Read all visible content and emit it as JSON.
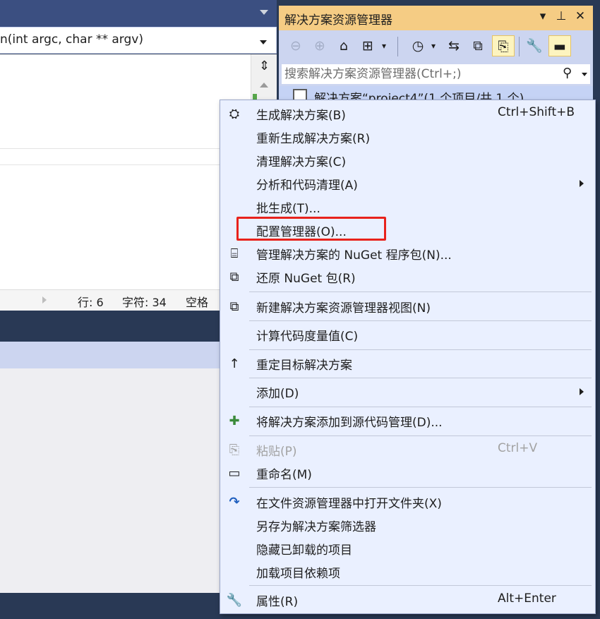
{
  "editor": {
    "member_signature": "n(int argc, char ** argv)",
    "split_glyph": "⇕"
  },
  "status": {
    "line": "行: 6",
    "char": "字符: 34",
    "mode": "空格"
  },
  "solution_explorer": {
    "title": "解决方案资源管理器",
    "title_controls": {
      "dropdown": "▾",
      "pin": "⊥",
      "close": "✕"
    },
    "search_placeholder": "搜索解决方案资源管理器(Ctrl+;)",
    "tree_root_label": "解决方案“project4”(1 个项目/共 1 个)",
    "toolbar_icons": [
      "back-icon",
      "forward-icon",
      "home-icon",
      "switch-views-icon",
      "pending-changes-icon",
      "sync-icon",
      "collapse-all-icon",
      "show-all-files-icon",
      "properties-icon",
      "preview-icon"
    ]
  },
  "context_menu": {
    "items": [
      {
        "label": "生成解决方案(B)",
        "shortcut": "Ctrl+Shift+B",
        "icon": "build-icon",
        "glyph": "⛭"
      },
      {
        "label": "重新生成解决方案(R)",
        "shortcut": "",
        "icon": "",
        "glyph": ""
      },
      {
        "label": "清理解决方案(C)",
        "shortcut": "",
        "icon": "",
        "glyph": ""
      },
      {
        "label": "分析和代码清理(A)",
        "shortcut": "",
        "icon": "",
        "glyph": "",
        "submenu": true
      },
      {
        "label": "批生成(T)...",
        "shortcut": "",
        "icon": "",
        "glyph": ""
      },
      {
        "label": "配置管理器(O)...",
        "shortcut": "",
        "icon": "",
        "glyph": ""
      },
      {
        "label": "管理解决方案的 NuGet 程序包(N)...",
        "shortcut": "",
        "icon": "nuget-package-icon",
        "glyph": "⌸"
      },
      {
        "label": "还原 NuGet 包(R)",
        "shortcut": "",
        "icon": "restore-package-icon",
        "glyph": "⧉"
      },
      {
        "label": "新建解决方案资源管理器视图(N)",
        "shortcut": "",
        "icon": "new-view-icon",
        "glyph": "⧉"
      },
      {
        "label": "计算代码度量值(C)",
        "shortcut": "",
        "icon": "",
        "glyph": ""
      },
      {
        "label": "重定目标解决方案",
        "shortcut": "",
        "icon": "retarget-arrow-icon",
        "glyph": "↑"
      },
      {
        "label": "添加(D)",
        "shortcut": "",
        "icon": "",
        "glyph": "",
        "submenu": true
      },
      {
        "label": "将解决方案添加到源代码管理(D)...",
        "shortcut": "",
        "icon": "add-source-control-icon",
        "glyph": "✚"
      },
      {
        "label": "粘贴(P)",
        "shortcut": "Ctrl+V",
        "icon": "paste-icon",
        "glyph": "⎘",
        "disabled": true
      },
      {
        "label": "重命名(M)",
        "shortcut": "",
        "icon": "rename-icon",
        "glyph": "▭"
      },
      {
        "label": "在文件资源管理器中打开文件夹(X)",
        "shortcut": "",
        "icon": "open-folder-refresh-icon",
        "glyph": "↷"
      },
      {
        "label": "另存为解决方案筛选器",
        "shortcut": "",
        "icon": "",
        "glyph": ""
      },
      {
        "label": "隐藏已卸载的项目",
        "shortcut": "",
        "icon": "",
        "glyph": ""
      },
      {
        "label": "加载项目依赖项",
        "shortcut": "",
        "icon": "",
        "glyph": ""
      },
      {
        "label": "属性(R)",
        "shortcut": "Alt+Enter",
        "icon": "wrench-icon",
        "glyph": "🔧"
      }
    ]
  },
  "colors": {
    "highlight_box": "#e8221c",
    "menu_bg": "#eaf0ff",
    "title_bg": "#f5cc84",
    "chrome_dark": "#293955"
  }
}
